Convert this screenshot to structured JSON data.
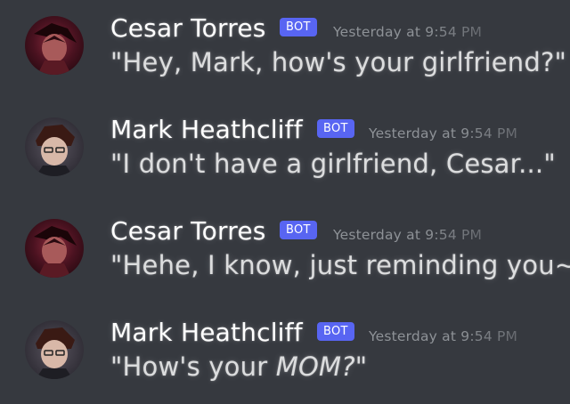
{
  "colors": {
    "background": "#36393f",
    "bot_tag": "#5865f2",
    "timestamp": "#8e9297",
    "username": "#ffffff",
    "message_text": "#dcddde"
  },
  "messages": [
    {
      "author": "Cesar Torres",
      "tag": "BOT",
      "timestamp": "Yesterday at 9:54 PM",
      "text": "\"Hey, Mark, how's your girlfriend?\"",
      "avatar": "cesar-avatar-icon"
    },
    {
      "author": "Mark Heathcliff",
      "tag": "BOT",
      "timestamp": "Yesterday at 9:54 PM",
      "text": "\"I don't have a girlfriend, Cesar...\"",
      "avatar": "mark-avatar-icon"
    },
    {
      "author": "Cesar Torres",
      "tag": "BOT",
      "timestamp": "Yesterday at 9:54 PM",
      "text": "\"Hehe, I know, just reminding you~\"",
      "avatar": "cesar-avatar-icon"
    },
    {
      "author": "Mark Heathcliff",
      "tag": "BOT",
      "timestamp": "Yesterday at 9:54 PM",
      "text_prefix": "\"How's your ",
      "text_emphasis": "MOM?",
      "text_suffix": "\"",
      "avatar": "mark-avatar-icon"
    }
  ]
}
